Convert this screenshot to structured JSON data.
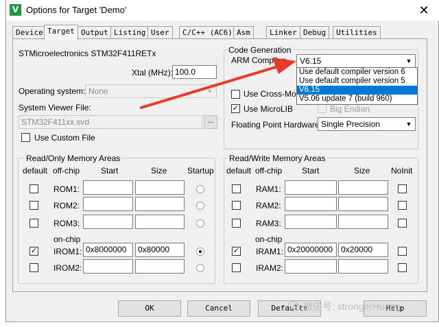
{
  "window": {
    "title": "Options for Target 'Demo'",
    "icon_letter": "V",
    "close_glyph": "✕"
  },
  "tabs": [
    {
      "label": "Device"
    },
    {
      "label": "Target"
    },
    {
      "label": "Output"
    },
    {
      "label": "Listing"
    },
    {
      "label": "User"
    },
    {
      "label": "C/C++ (AC6)"
    },
    {
      "label": "Asm"
    },
    {
      "label": "Linker"
    },
    {
      "label": "Debug"
    },
    {
      "label": "Utilities"
    }
  ],
  "target": {
    "device_name": "STMicroelectronics STM32F411RETx",
    "xtal_label": "Xtal (MHz):",
    "xtal_value": "100.0",
    "os_label": "Operating system:",
    "os_value": "None",
    "svd_label": "System Viewer File:",
    "svd_value": "STM32F411xx.svd",
    "browse_label": "...",
    "custom_file_label": "Use Custom File"
  },
  "code_gen": {
    "title": "Code Generation",
    "compiler_label": "ARM Compiler:",
    "compiler_value": "V6.15",
    "options": [
      "Use default compiler version 6",
      "Use default compiler version 5",
      "V6.15",
      "V5.06 update 7 (build 960)"
    ],
    "selected_index": 2,
    "cross_module_label": "Use Cross-Module Optimization",
    "microlib_label": "Use MicroLIB",
    "microlib_checked": true,
    "big_endian_label": "Big Endian",
    "fp_label": "Floating Point Hardware:",
    "fp_value": "Single Precision"
  },
  "ro_memory": {
    "title": "Read/Only Memory Areas",
    "headers": {
      "default": "default",
      "offchip": "off-chip",
      "start": "Start",
      "size": "Size",
      "startup": "Startup"
    },
    "onchip_label": "on-chip",
    "rows": [
      {
        "name": "ROM1:",
        "start": "",
        "size": "",
        "default": false,
        "startup": false
      },
      {
        "name": "ROM2:",
        "start": "",
        "size": "",
        "default": false,
        "startup": false
      },
      {
        "name": "ROM3:",
        "start": "",
        "size": "",
        "default": false,
        "startup": false
      },
      {
        "name": "IROM1:",
        "start": "0x8000000",
        "size": "0x80000",
        "default": true,
        "startup": true
      },
      {
        "name": "IROM2:",
        "start": "",
        "size": "",
        "default": false,
        "startup": false
      }
    ]
  },
  "rw_memory": {
    "title": "Read/Write Memory Areas",
    "headers": {
      "default": "default",
      "offchip": "off-chip",
      "start": "Start",
      "size": "Size",
      "noinit": "NoInit"
    },
    "onchip_label": "on-chip",
    "rows": [
      {
        "name": "RAM1:",
        "start": "",
        "size": "",
        "default": false
      },
      {
        "name": "RAM2:",
        "start": "",
        "size": "",
        "default": false
      },
      {
        "name": "RAM3:",
        "start": "",
        "size": "",
        "default": false
      },
      {
        "name": "IRAM1:",
        "start": "0x20000000",
        "size": "0x20000",
        "default": true
      },
      {
        "name": "IRAM2:",
        "start": "",
        "size": "",
        "default": false
      }
    ]
  },
  "buttons": {
    "ok": "OK",
    "cancel": "Cancel",
    "defaults": "Defaults",
    "help": "Help"
  },
  "watermark": "微信号: strongerHuang",
  "colors": {
    "selection": "#0078d7",
    "arrow": "#e8392b"
  }
}
